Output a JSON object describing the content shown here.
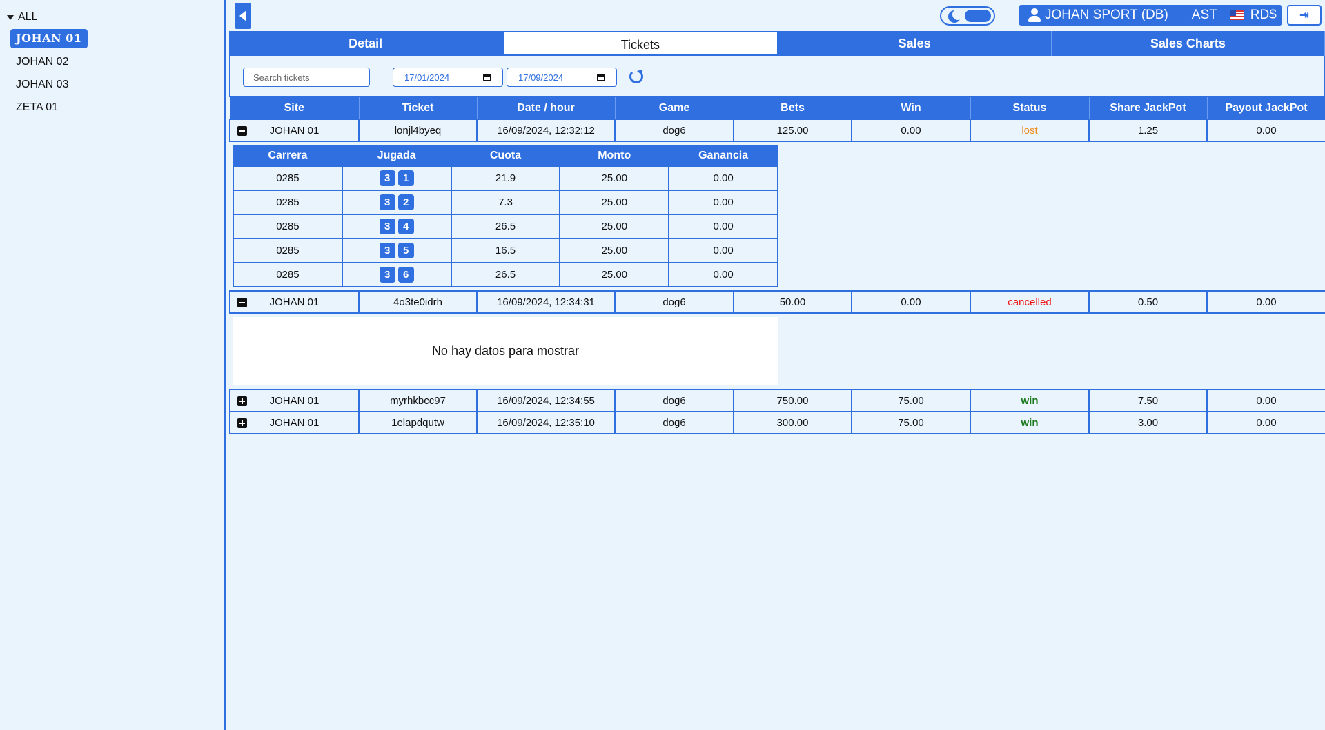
{
  "sidebar": {
    "root_label": "ALL",
    "items": [
      {
        "label": "JOHAN 01",
        "active": true
      },
      {
        "label": "JOHAN 02",
        "active": false
      },
      {
        "label": "JOHAN 03",
        "active": false
      },
      {
        "label": "ZETA 01",
        "active": false
      }
    ]
  },
  "header": {
    "user_name": "JOHAN SPORT (DB)",
    "timezone": "AST",
    "currency": "RD$"
  },
  "tabs": [
    {
      "label": "Detail"
    },
    {
      "label": "Tickets"
    },
    {
      "label": "Sales"
    },
    {
      "label": "Sales Charts"
    }
  ],
  "filters": {
    "search_placeholder": "Search tickets",
    "date_from": "17/01/2024",
    "date_to": "17/09/2024"
  },
  "table": {
    "columns": [
      "Site",
      "Ticket",
      "Date / hour",
      "Game",
      "Bets",
      "Win",
      "Status",
      "Share JackPot",
      "Payout JackPot"
    ],
    "rows": [
      {
        "site": "JOHAN 01",
        "ticket": "lonjl4byeq",
        "date": "16/09/2024, 12:32:12",
        "game": "dog6",
        "bets": "125.00",
        "win": "0.00",
        "status": "lost",
        "share": "1.25",
        "payout": "0.00"
      },
      {
        "site": "JOHAN 01",
        "ticket": "4o3te0idrh",
        "date": "16/09/2024, 12:34:31",
        "game": "dog6",
        "bets": "50.00",
        "win": "0.00",
        "status": "cancelled",
        "share": "0.50",
        "payout": "0.00"
      },
      {
        "site": "JOHAN 01",
        "ticket": "myrhkbcc97",
        "date": "16/09/2024, 12:34:55",
        "game": "dog6",
        "bets": "750.00",
        "win": "75.00",
        "status": "win",
        "share": "7.50",
        "payout": "0.00"
      },
      {
        "site": "JOHAN 01",
        "ticket": "1elapdqutw",
        "date": "16/09/2024, 12:35:10",
        "game": "dog6",
        "bets": "300.00",
        "win": "75.00",
        "status": "win",
        "share": "3.00",
        "payout": "0.00"
      }
    ]
  },
  "subtable": {
    "columns": [
      "Carrera",
      "Jugada",
      "Cuota",
      "Monto",
      "Ganancia"
    ],
    "rows": [
      {
        "carrera": "0285",
        "jugada": [
          "3",
          "1"
        ],
        "cuota": "21.9",
        "monto": "25.00",
        "ganancia": "0.00"
      },
      {
        "carrera": "0285",
        "jugada": [
          "3",
          "2"
        ],
        "cuota": "7.3",
        "monto": "25.00",
        "ganancia": "0.00"
      },
      {
        "carrera": "0285",
        "jugada": [
          "3",
          "4"
        ],
        "cuota": "26.5",
        "monto": "25.00",
        "ganancia": "0.00"
      },
      {
        "carrera": "0285",
        "jugada": [
          "3",
          "5"
        ],
        "cuota": "16.5",
        "monto": "25.00",
        "ganancia": "0.00"
      },
      {
        "carrera": "0285",
        "jugada": [
          "3",
          "6"
        ],
        "cuota": "26.5",
        "monto": "25.00",
        "ganancia": "0.00"
      }
    ]
  },
  "no_data_text": "No hay datos para mostrar"
}
